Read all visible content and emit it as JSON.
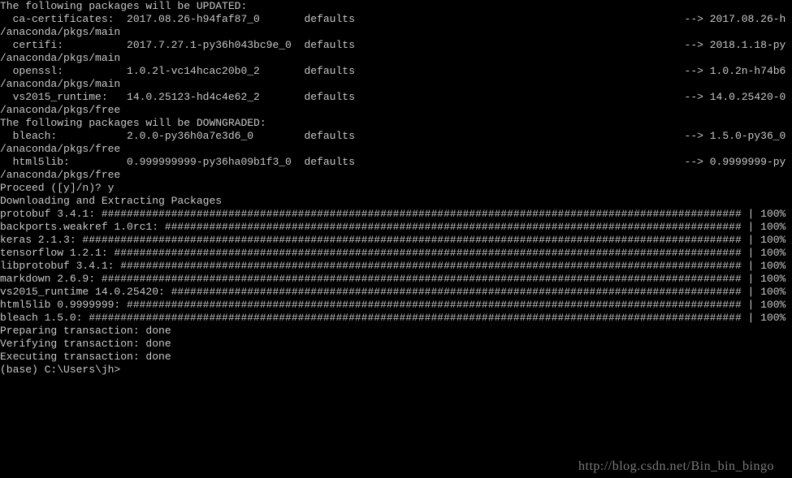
{
  "headers": {
    "updated": "The following packages will be UPDATED:",
    "downgraded": "The following packages will be DOWNGRADED:"
  },
  "updated": [
    {
      "name": "  ca-certificates:",
      "ver": "2017.08.26-h94faf87_0     ",
      "chan": "defaults",
      "arrow": "--> 2017.08.26-h",
      "path": "/anaconda/pkgs/main"
    },
    {
      "name": "  certifi:        ",
      "ver": "2017.7.27.1-py36h043bc9e_0",
      "chan": "defaults",
      "arrow": "--> 2018.1.18-py",
      "path": "/anaconda/pkgs/main"
    },
    {
      "name": "  openssl:        ",
      "ver": "1.0.2l-vc14hcac20b0_2     ",
      "chan": "defaults",
      "arrow": "--> 1.0.2n-h74b6",
      "path": "/anaconda/pkgs/main"
    },
    {
      "name": "  vs2015_runtime: ",
      "ver": "14.0.25123-hd4c4e62_2     ",
      "chan": "defaults",
      "arrow": "--> 14.0.25420-0",
      "path": "/anaconda/pkgs/free"
    }
  ],
  "downgraded": [
    {
      "name": "  bleach:         ",
      "ver": "2.0.0-py36h0a7e3d6_0      ",
      "chan": "defaults",
      "arrow": "--> 1.5.0-py36_0",
      "path": "/anaconda/pkgs/free"
    },
    {
      "name": "  html5lib:       ",
      "ver": "0.999999999-py36ha09b1f3_0",
      "chan": "defaults",
      "arrow": "--> 0.9999999-py",
      "path": "/anaconda/pkgs/free"
    }
  ],
  "proceed": "Proceed ([y]/n)? y",
  "download_header": "Downloading and Extracting Packages",
  "downloads": [
    {
      "label": "protobuf 3.4.1: ",
      "pct": "100%"
    },
    {
      "label": "backports.weakref 1.0rc1: ",
      "pct": "100%"
    },
    {
      "label": "keras 2.1.3: ",
      "pct": "100%"
    },
    {
      "label": "tensorflow 1.2.1: ",
      "pct": "100%"
    },
    {
      "label": "libprotobuf 3.4.1: ",
      "pct": "100%"
    },
    {
      "label": "markdown 2.6.9: ",
      "pct": "100%"
    },
    {
      "label": "vs2015_runtime 14.0.25420: ",
      "pct": "100%"
    },
    {
      "label": "html5lib 0.9999999: ",
      "pct": "100%"
    },
    {
      "label": "bleach 1.5.0: ",
      "pct": "100%"
    }
  ],
  "transactions": {
    "preparing": "Preparing transaction: done",
    "verifying": "Verifying transaction: done",
    "executing": "Executing transaction: done"
  },
  "prompt": "(base) C:\\Users\\jh>",
  "watermark": "http://blog.csdn.net/Bin_bin_bingo",
  "colwidths": {
    "nameCol": 20,
    "verCol": 27,
    "chanCol": 8,
    "barEnd": 116,
    "pctCol": 6
  }
}
